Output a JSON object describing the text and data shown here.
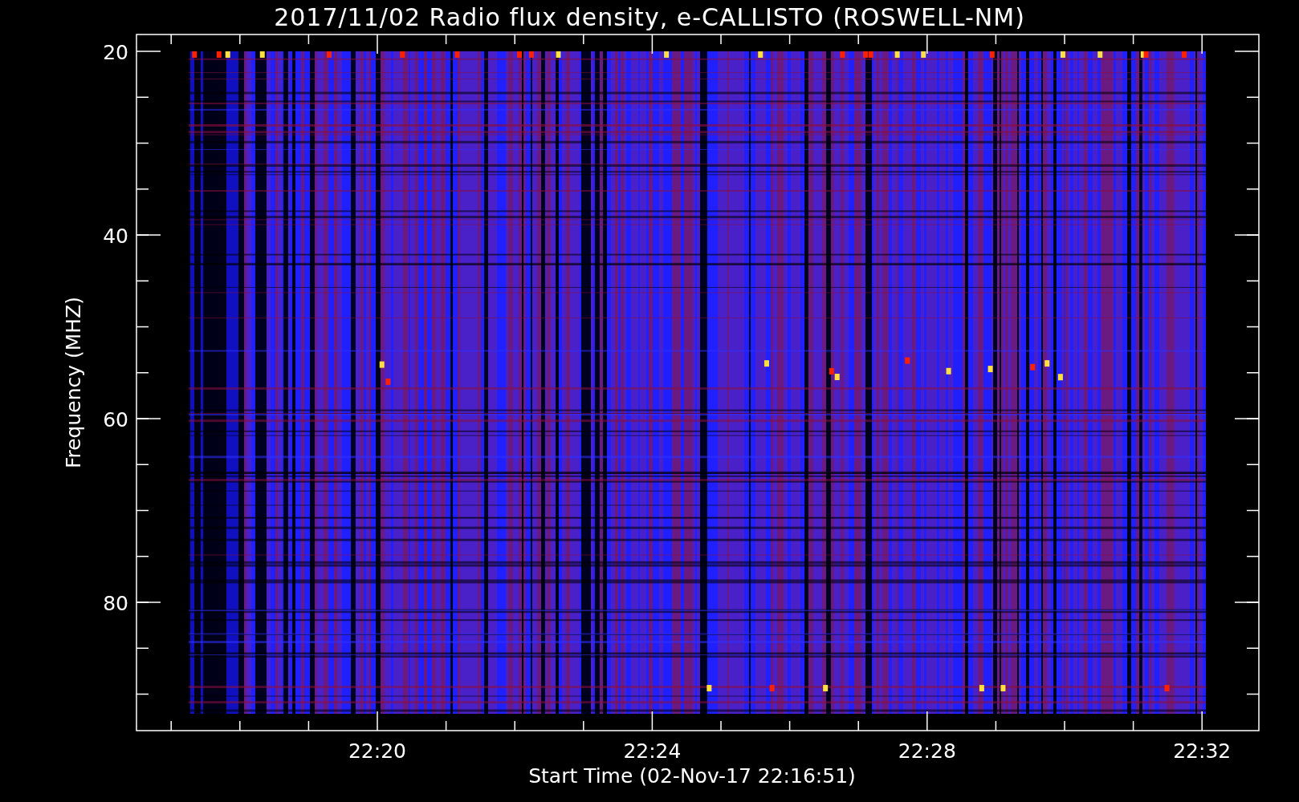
{
  "title": "2017/11/02  Radio flux density, e-CALLISTO (ROSWELL-NM)",
  "y_axis": {
    "label": "Frequency (MHZ)",
    "ticks": [
      "20",
      "40",
      "60",
      "80"
    ]
  },
  "x_axis": {
    "label": "Start Time (02-Nov-17 22:16:51)",
    "ticks": [
      "22:20",
      "22:24",
      "22:28",
      "22:32"
    ]
  }
}
